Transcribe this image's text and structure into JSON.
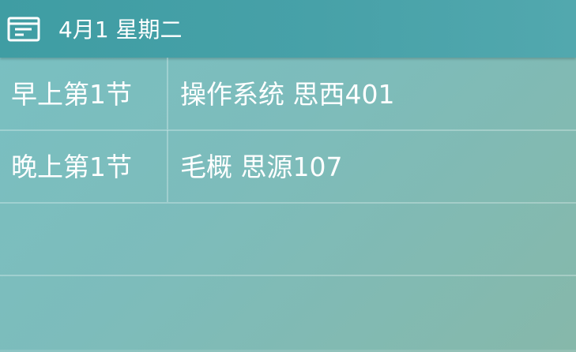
{
  "header": {
    "date_label": "4月1 星期二",
    "icon": "calendar-icon"
  },
  "schedule": [
    {
      "time": "早上第1节",
      "course": "操作系统 思西401"
    },
    {
      "time": "晚上第1节",
      "course": "毛概 思源107"
    }
  ],
  "colors": {
    "header_bg": "#47a1a8",
    "body_bg": "#7dbcbb",
    "text": "#ffffff"
  }
}
